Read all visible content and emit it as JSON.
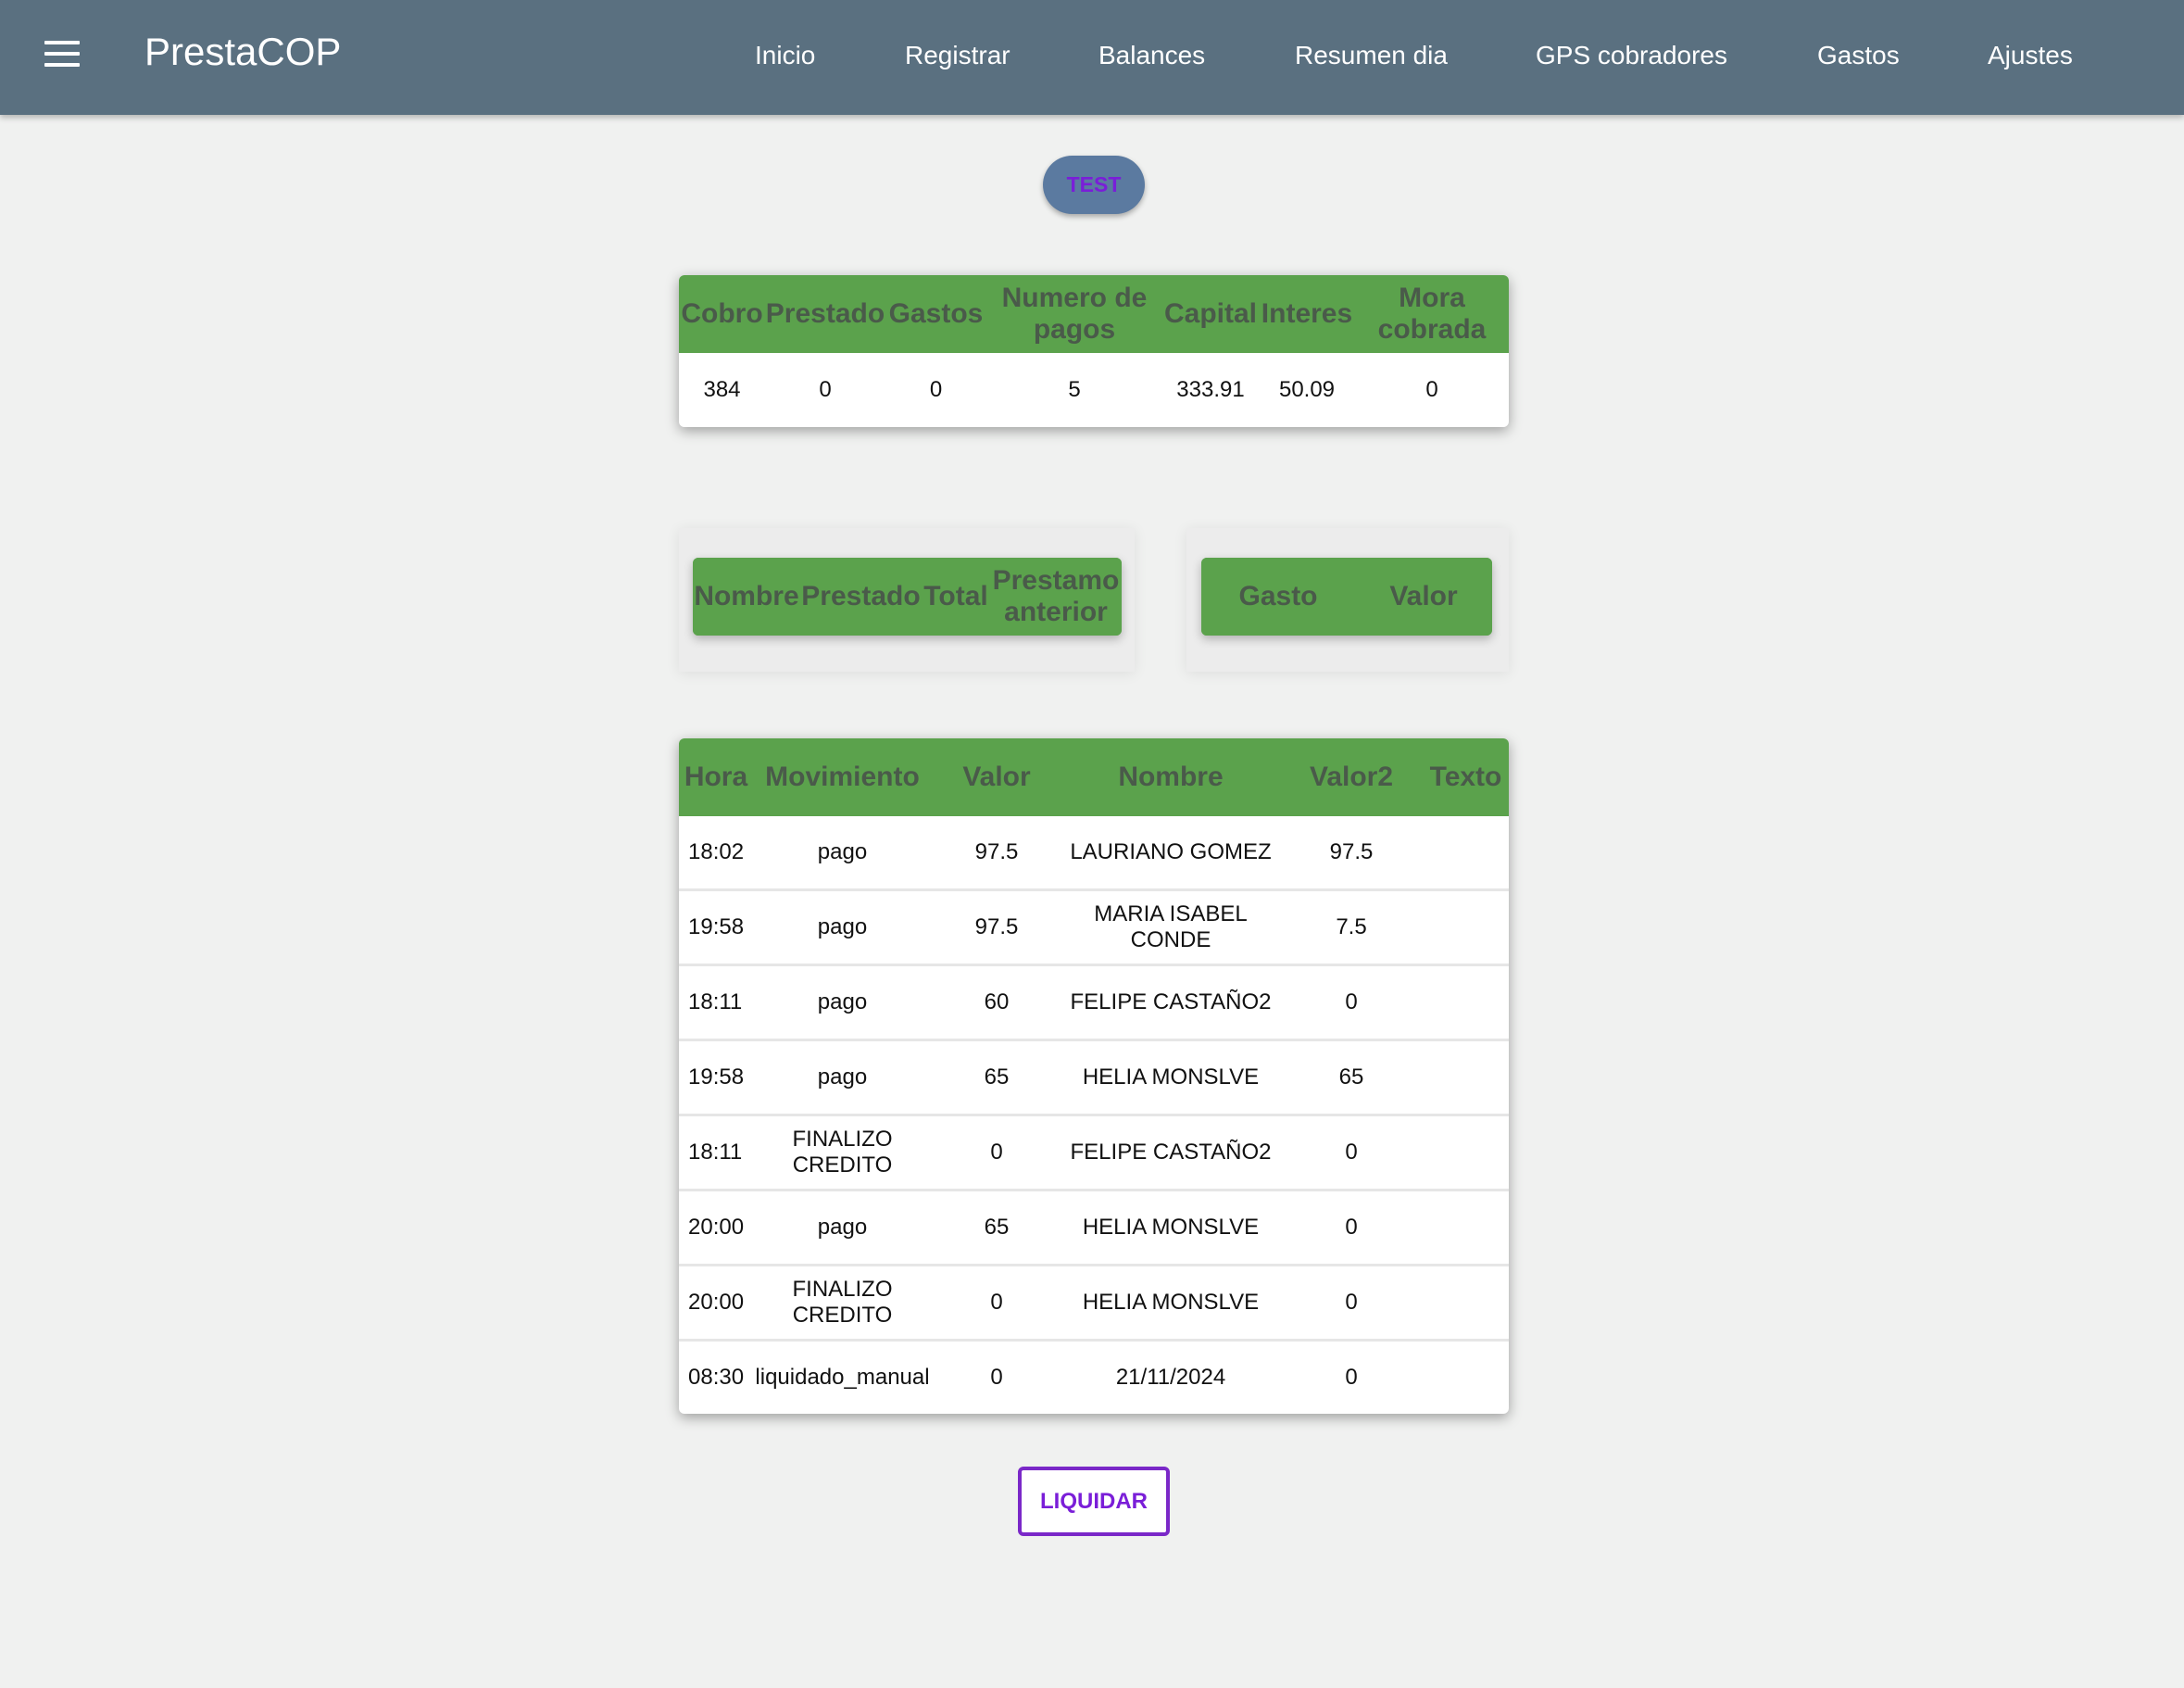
{
  "app": {
    "title": "PrestaCOP",
    "menu_icon": "hamburger-menu-icon"
  },
  "nav": {
    "items": [
      "Inicio",
      "Registrar",
      "Balances",
      "Resumen dia",
      "GPS cobradores",
      "Gastos",
      "Ajustes"
    ]
  },
  "test_button": "TEST",
  "summary": {
    "headers": [
      "Cobro",
      "Prestado",
      "Gastos",
      "Numero de pagos",
      "Capital",
      "Interes",
      "Mora cobrada"
    ],
    "values": [
      "384",
      "0",
      "0",
      "5",
      "333.91",
      "50.09",
      "0"
    ]
  },
  "loans_table": {
    "headers": [
      "Nombre",
      "Prestado",
      "Total",
      "Prestamo anterior"
    ]
  },
  "expenses_table": {
    "headers": [
      "Gasto",
      "Valor"
    ]
  },
  "movements": {
    "headers": [
      "Hora",
      "Movimiento",
      "Valor",
      "Nombre",
      "Valor2",
      "Texto"
    ],
    "rows": [
      [
        "18:02",
        "pago",
        "97.5",
        "LAURIANO GOMEZ",
        "97.5",
        ""
      ],
      [
        "19:58",
        "pago",
        "97.5",
        "MARIA ISABEL CONDE",
        "7.5",
        ""
      ],
      [
        "18:11",
        "pago",
        "60",
        "FELIPE CASTAÑO2",
        "0",
        ""
      ],
      [
        "19:58",
        "pago",
        "65",
        "HELIA MONSLVE",
        "65",
        ""
      ],
      [
        "18:11",
        "FINALIZO CREDITO",
        "0",
        "FELIPE CASTAÑO2",
        "0",
        ""
      ],
      [
        "20:00",
        "pago",
        "65",
        "HELIA MONSLVE",
        "0",
        ""
      ],
      [
        "20:00",
        "FINALIZO CREDITO",
        "0",
        "HELIA MONSLVE",
        "0",
        ""
      ],
      [
        "08:30",
        "liquidado_manual",
        "0",
        "21/11/2024",
        "0",
        ""
      ]
    ]
  },
  "liquidar_button": "LIQUIDAR",
  "colors": {
    "topbar": "#5a7080",
    "header_green": "#5ba24c",
    "accent_purple": "#7a1ed8",
    "background": "#f0f1f0"
  }
}
